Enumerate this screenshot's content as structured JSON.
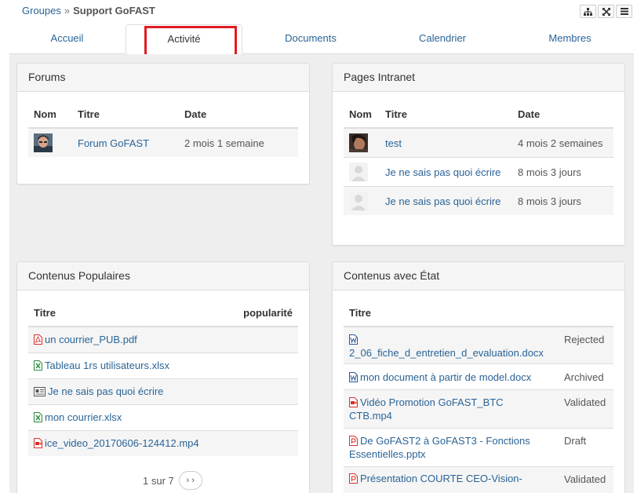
{
  "breadcrumb": {
    "parent": "Groupes",
    "separator": "»",
    "current": "Support GoFAST"
  },
  "toolbar": {
    "icons": [
      "sitemap-icon",
      "expand-icon",
      "menu-icon"
    ]
  },
  "tabs": [
    {
      "label": "Accueil"
    },
    {
      "label": "Activité"
    },
    {
      "label": "Documents"
    },
    {
      "label": "Calendrier"
    },
    {
      "label": "Membres"
    }
  ],
  "forums": {
    "title": "Forums",
    "headers": {
      "nom": "Nom",
      "titre": "Titre",
      "date": "Date"
    },
    "rows": [
      {
        "titre": "Forum GoFAST",
        "date": "2 mois 1 semaine"
      }
    ]
  },
  "pages": {
    "title": "Pages Intranet",
    "headers": {
      "nom": "Nom",
      "titre": "Titre",
      "date": "Date"
    },
    "rows": [
      {
        "titre": "test",
        "date": "4 mois 2 semaines"
      },
      {
        "titre": "Je ne sais pas quoi écrire",
        "date": "8 mois 3 jours"
      },
      {
        "titre": "Je ne sais pas quoi écrire",
        "date": "8 mois 3 jours"
      }
    ]
  },
  "popular": {
    "title": "Contenus Populaires",
    "headers": {
      "titre": "Titre",
      "popularite": "popularité"
    },
    "rows": [
      {
        "icon": "pdf-file-icon",
        "titre": "un courrier_PUB.pdf"
      },
      {
        "icon": "excel-file-icon",
        "titre": "Tableau 1rs utilisateurs.xlsx"
      },
      {
        "icon": "article-icon",
        "titre": "Je ne sais pas quoi écrire"
      },
      {
        "icon": "excel-file-icon",
        "titre": "mon courrier.xlsx"
      },
      {
        "icon": "video-file-icon",
        "titre": "ice_video_20170606-124412.mp4"
      }
    ],
    "pager": {
      "text": "1 sur 7",
      "next": "› ›"
    }
  },
  "state": {
    "title": "Contenus avec État",
    "headers": {
      "titre": "Titre"
    },
    "rows": [
      {
        "icon": "word-file-icon",
        "titre": "2_06_fiche_d_entretien_d_evaluation.docx",
        "state": "Rejected"
      },
      {
        "icon": "word-file-icon",
        "titre": "mon document à partir de model.docx",
        "state": "Archived"
      },
      {
        "icon": "video-file-icon",
        "line1": "Vidéo Promotion GoFAST_BTC",
        "line2": "CTB.mp4",
        "state": "Validated"
      },
      {
        "icon": "powerpoint-file-icon",
        "line1": "De GoFAST2 à GoFAST3 - Fonctions",
        "line2": "Essentielles.pptx",
        "state": "Draft"
      },
      {
        "icon": "powerpoint-file-icon",
        "line1": "Présentation COURTE CEO-Vision-",
        "state": "Validated"
      }
    ]
  },
  "colors": {
    "link": "#2a6496",
    "highlight": "#e11b22",
    "pdf": "#d9302a",
    "excel": "#2e8b3e",
    "word": "#2b5797"
  }
}
